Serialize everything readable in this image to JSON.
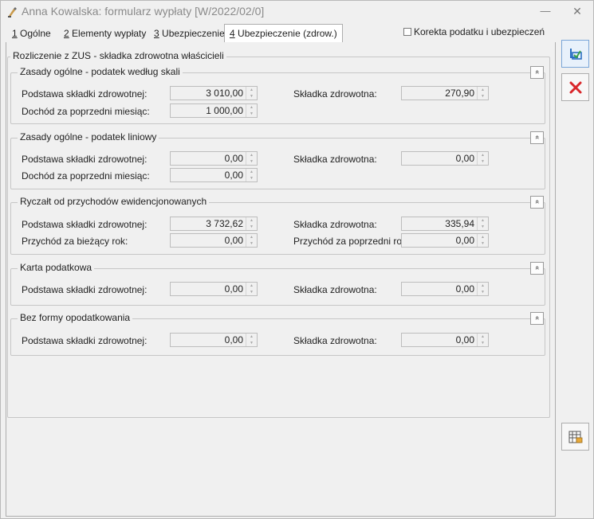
{
  "window": {
    "title": "Anna Kowalska: formularz wypłaty [W/2022/02/0]",
    "minimize_glyph": "—",
    "close_glyph": "✕"
  },
  "tabs": [
    {
      "key": "1",
      "label": " Ogólne"
    },
    {
      "key": "2",
      "label": " Elementy wypłaty"
    },
    {
      "key": "3",
      "label": " Ubezpieczenie"
    },
    {
      "key": "4",
      "label": " Ubezpieczenie (zdrow.)",
      "active": true
    }
  ],
  "korekta": {
    "label": "Korekta podatku i ubezpieczeń",
    "checked": false
  },
  "main_group": {
    "title": "Rozliczenie z ZUS - składka zdrowotna właścicieli"
  },
  "sections": {
    "skala": {
      "title": "Zasady ogólne - podatek według skali",
      "podstawa_label": "Podstawa składki zdrowotnej:",
      "podstawa_value": "3 010,00",
      "skladka_label": "Składka zdrowotna:",
      "skladka_value": "270,90",
      "dochod_label": "Dochód za poprzedni miesiąc:",
      "dochod_value": "1 000,00"
    },
    "liniowy": {
      "title": "Zasady ogólne - podatek liniowy",
      "podstawa_label": "Podstawa składki zdrowotnej:",
      "podstawa_value": "0,00",
      "skladka_label": "Składka zdrowotna:",
      "skladka_value": "0,00",
      "dochod_label": "Dochód za poprzedni miesiąc:",
      "dochod_value": "0,00"
    },
    "ryczalt": {
      "title": "Ryczałt od przychodów ewidencjonowanych",
      "podstawa_label": "Podstawa składki zdrowotnej:",
      "podstawa_value": "3 732,62",
      "skladka_label": "Składka zdrowotna:",
      "skladka_value": "335,94",
      "przychod_biezacy_label": "Przychód za bieżący rok:",
      "przychod_biezacy_value": "0,00",
      "przychod_poprzedni_label": "Przychód za poprzedni rok:",
      "przychod_poprzedni_value": "0,00"
    },
    "karta": {
      "title": "Karta podatkowa",
      "podstawa_label": "Podstawa składki zdrowotnej:",
      "podstawa_value": "0,00",
      "skladka_label": "Składka zdrowotna:",
      "skladka_value": "0,00"
    },
    "bez_formy": {
      "title": "Bez formy opodatkowania",
      "podstawa_label": "Podstawa składki zdrowotnej:",
      "podstawa_value": "0,00",
      "skladka_label": "Składka zdrowotna:",
      "skladka_value": "0,00"
    }
  },
  "collapse_glyph": "»",
  "icons": {
    "save": "save-icon",
    "cancel": "cancel-icon",
    "calculator": "spreadsheet-icon"
  },
  "colors": {
    "cancel_red": "#d9262a",
    "save_blue": "#2a6fc2"
  }
}
